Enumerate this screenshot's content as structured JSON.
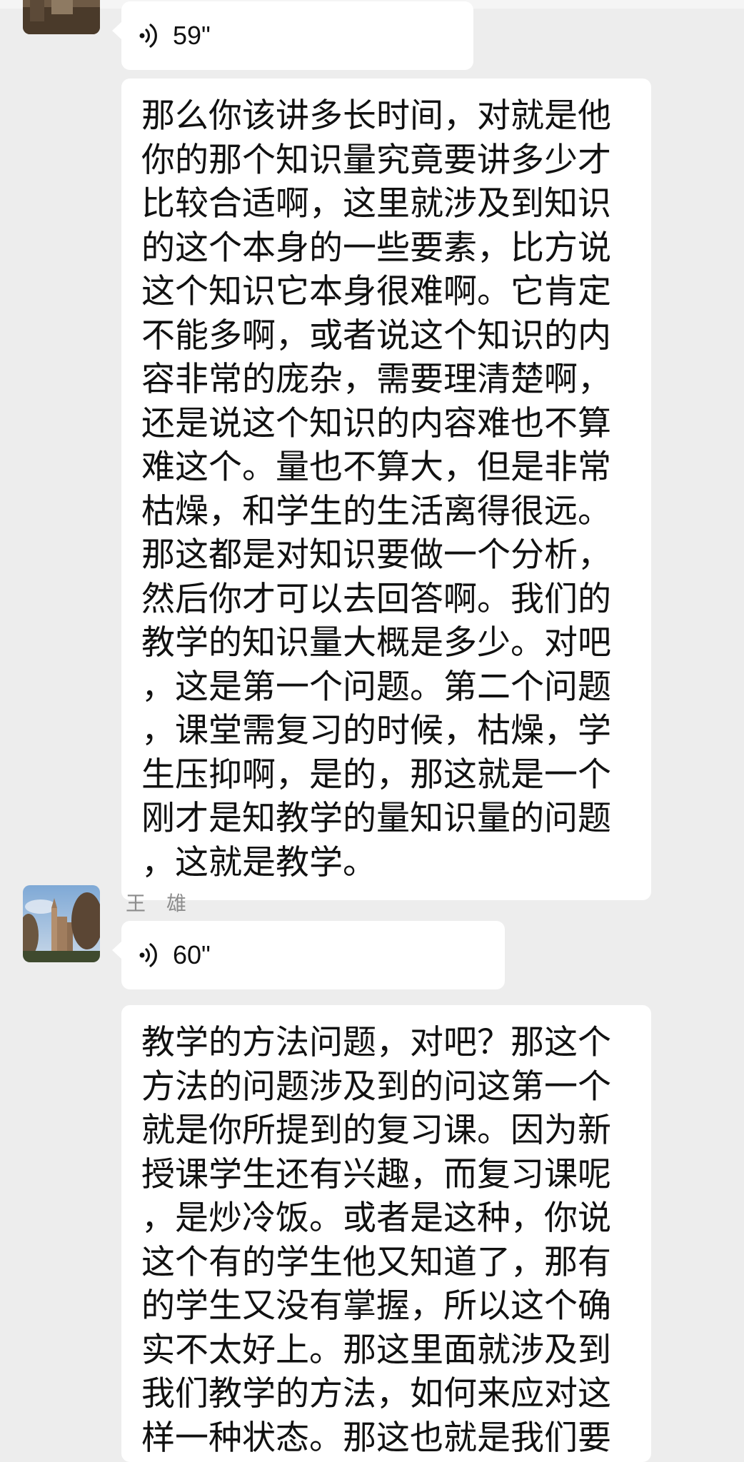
{
  "messages": [
    {
      "voice_duration": "59\"",
      "transcript": "那么你该讲多长时间，对就是他你的那个知识量究竟要讲多少才比较合适啊，这里就涉及到知识的这个本身的一些要素，比方说这个知识它本身很难啊。它肯定不能多啊，或者说这个知识的内容非常的庞杂，需要理清楚啊，还是说这个知识的内容难也不算难这个。量也不算大，但是非常枯燥，和学生的生活离得很远。那这都是对知识要做一个分析，然后你才可以去回答啊。我们的教学的知识量大概是多少。对吧，这是第一个问题。第二个问题，课堂需复习的时候，枯燥，学生压抑啊，是的，那这就是一个刚才是知教学的量知识量的问题，这就是教学。"
    },
    {
      "sender": "王　雄",
      "voice_duration": "60\"",
      "transcript": "教学的方法问题，对吧？那这个方法的问题涉及到的问这第一个就是你所提到的复习课。因为新授课学生还有兴趣，而复习课呢，是炒冷饭。或者是这种，你说这个有的学生他又知道了，那有的学生又没有掌握，所以这个确实不太好上。那这里面就涉及到我们教学的方法，如何来应对这样一种状态。那这也就是我们要去调动学生的学习积极"
    }
  ]
}
